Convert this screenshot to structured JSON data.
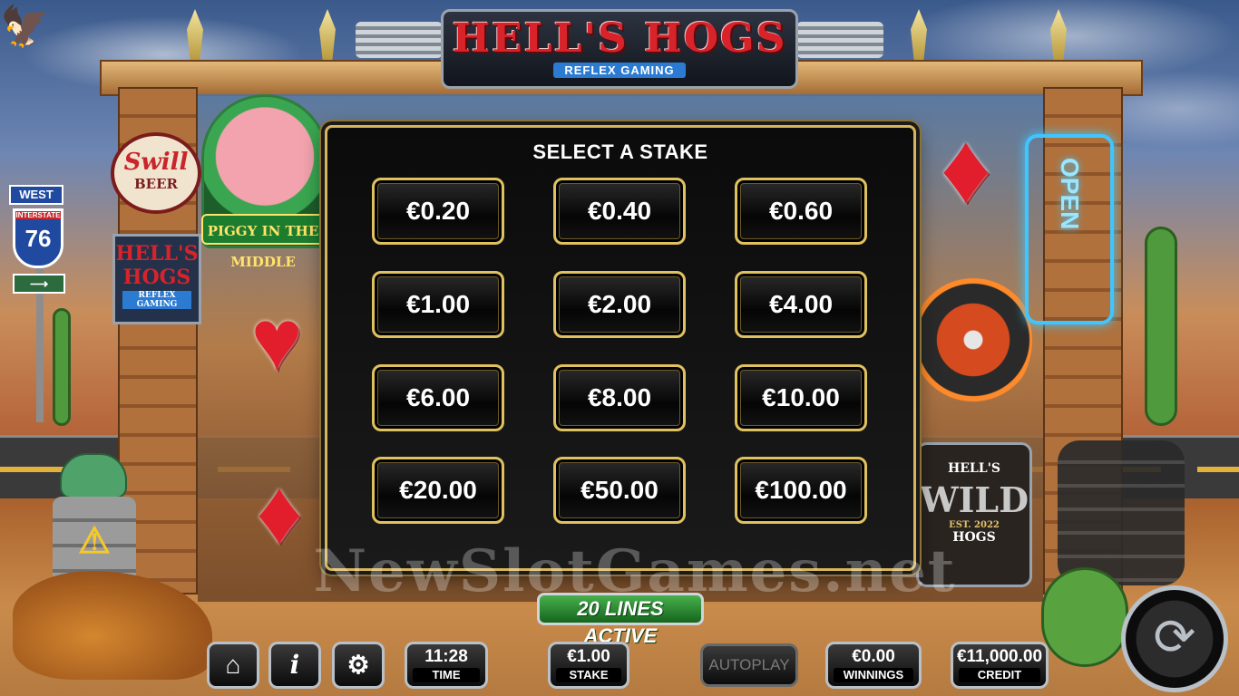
{
  "game": {
    "title": "HELL'S HOGS",
    "provider": "REFLEX GAMING"
  },
  "scenery": {
    "swill_sign": [
      "Swill",
      "BEER"
    ],
    "hells_sign": [
      "HELL'S HOGS",
      "REFLEX GAMING"
    ],
    "road_sign": [
      "WEST",
      "INTERSTATE",
      "76"
    ],
    "piggy_label": "PIGGY IN THE MIDDLE",
    "open_sign": "OPEN",
    "wild_badge": [
      "HELL'S",
      "WILD",
      "EST. 2022",
      "HOGS"
    ],
    "watermark": "NewSlotGames.net"
  },
  "stake_dialog": {
    "title": "SELECT A STAKE",
    "options": [
      "€0.20",
      "€0.40",
      "€0.60",
      "€1.00",
      "€2.00",
      "€4.00",
      "€6.00",
      "€8.00",
      "€10.00",
      "€20.00",
      "€50.00",
      "€100.00"
    ]
  },
  "lines_active": "20 LINES ACTIVE",
  "bottom_bar": {
    "time": {
      "value": "11:28",
      "label": "TIME"
    },
    "stake": {
      "value": "€1.00",
      "label": "STAKE"
    },
    "autoplay": "AUTOPLAY",
    "winnings": {
      "value": "€0.00",
      "label": "WINNINGS"
    },
    "credit": {
      "value": "€11,000.00",
      "label": "CREDIT"
    }
  },
  "icons": {
    "home": "home-icon",
    "info": "info-icon",
    "settings": "gear-icon",
    "spin": "spin-icon"
  },
  "colors": {
    "accent_gold": "#e0c15f",
    "logo_red": "#d8232a",
    "lines_green": "#2f8f35"
  }
}
